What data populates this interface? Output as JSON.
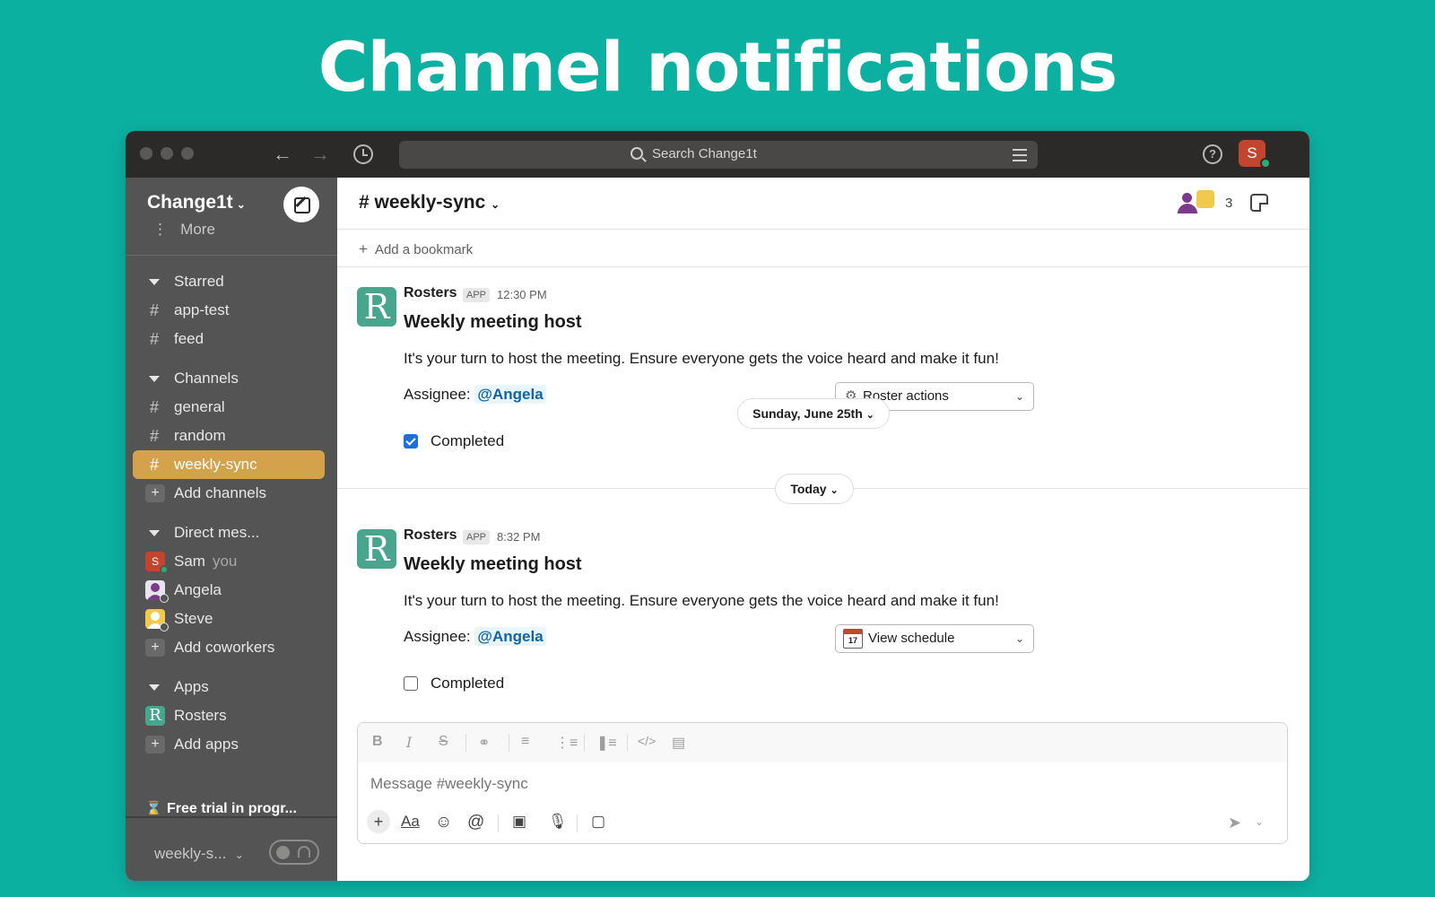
{
  "hero": {
    "title": "Channel notifications"
  },
  "topbar": {
    "search_placeholder": "Search Change1t",
    "user_initial": "S",
    "help_glyph": "?"
  },
  "workspace": {
    "name": "Change1t"
  },
  "sidebar": {
    "more_label": "More",
    "sections": {
      "starred": "Starred",
      "channels": "Channels",
      "direct": "Direct mes...",
      "apps": "Apps"
    },
    "starred_items": [
      "app-test",
      "feed"
    ],
    "channel_items": [
      "general",
      "random",
      "weekly-sync"
    ],
    "add_channels": "Add channels",
    "dms": [
      {
        "name": "Sam",
        "sublabel": "you",
        "initial": "S"
      },
      {
        "name": "Angela"
      },
      {
        "name": "Steve"
      }
    ],
    "add_coworkers": "Add coworkers",
    "app_items": [
      "Rosters"
    ],
    "add_apps": "Add apps",
    "trial": "Free trial in progr...",
    "footer_channel": "weekly-s..."
  },
  "channel": {
    "name": "weekly-sync",
    "member_count": "3",
    "bookmark_label": "Add a bookmark"
  },
  "date_dividers": [
    "Sunday, June 25th",
    "Today"
  ],
  "messages": [
    {
      "sender": "Rosters",
      "badge": "APP",
      "time": "12:30 PM",
      "title": "Weekly meeting host",
      "body": "It's your turn to host the meeting. Ensure everyone gets the voice heard and make it fun!",
      "assignee_label": "Assignee:",
      "assignee": "@Angela",
      "select_label": "Roster actions",
      "checkbox_label": "Completed",
      "checked": true
    },
    {
      "sender": "Rosters",
      "badge": "APP",
      "time": "8:32 PM",
      "title": "Weekly meeting host",
      "body": "It's your turn to host the meeting. Ensure everyone gets the voice heard and make it fun!",
      "assignee_label": "Assignee:",
      "assignee": "@Angela",
      "select_label": "View schedule",
      "calendar_day": "17",
      "checkbox_label": "Completed",
      "checked": false
    }
  ],
  "composer": {
    "placeholder": "Message #weekly-sync",
    "format_tools": [
      "bold-icon",
      "italic-icon",
      "strikethrough-icon",
      "link-icon",
      "ordered-list-icon",
      "bullet-list-icon",
      "blockquote-icon",
      "code-icon",
      "code-block-icon"
    ],
    "bottom_tools": [
      "plus-icon",
      "format-text-icon",
      "emoji-icon",
      "mention-icon",
      "video-icon",
      "microphone-icon",
      "slash-command-icon"
    ],
    "text_format_label": "Aa"
  },
  "colors": {
    "background": "#0cb0a1",
    "sidebar": "#535453",
    "active_channel": "#d5a24c",
    "mention": "#1264a3",
    "app_avatar": "#4aa58f"
  },
  "avatar_letter": "R"
}
